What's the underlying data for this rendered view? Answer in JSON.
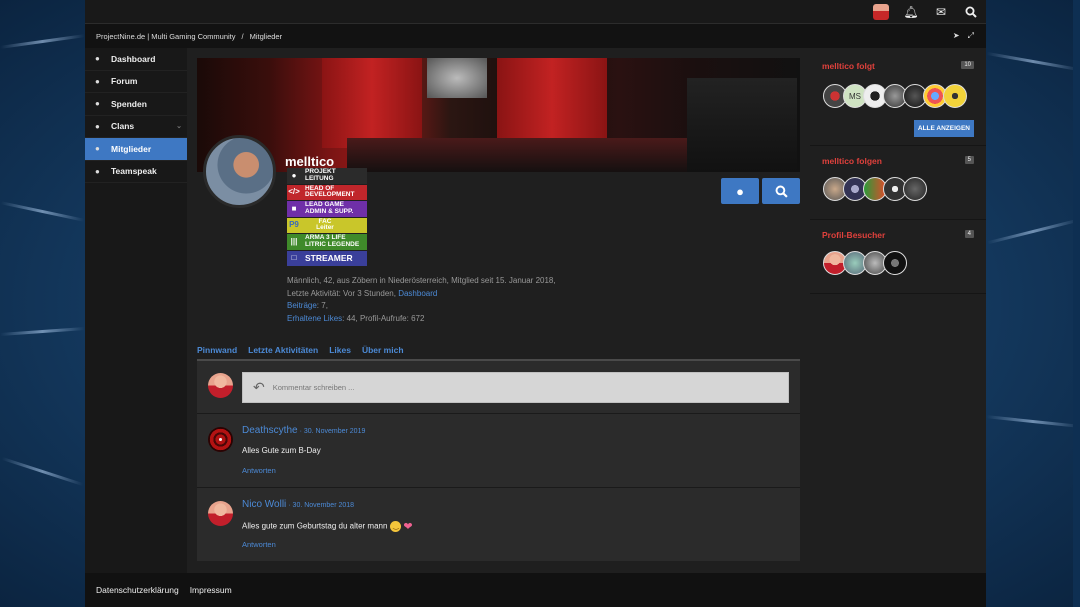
{
  "breadcrumb": {
    "site": "ProjectNine.de | Multi Gaming Community",
    "separator": "/",
    "current": "Mitglieder"
  },
  "topbar": {
    "icons": [
      "user-avatar",
      "bell-icon",
      "chat-icon",
      "search-icon"
    ]
  },
  "sidebar": {
    "items": [
      {
        "label": "Dashboard",
        "icon": "chat-icon",
        "active": false
      },
      {
        "label": "Forum",
        "icon": "chat-icon",
        "active": false
      },
      {
        "label": "Spenden",
        "icon": "chat-icon",
        "active": false
      },
      {
        "label": "Clans",
        "icon": "chat-icon",
        "active": false
      },
      {
        "label": "Mitglieder",
        "icon": "users-icon",
        "active": true
      },
      {
        "label": "Teamspeak",
        "icon": "chat-icon",
        "active": false
      }
    ]
  },
  "profile": {
    "username": "melltico",
    "badges": [
      {
        "line1": "PROJEKT",
        "line2": "LEITUNG",
        "bg": "#2b2b2b",
        "icon": "user-icon"
      },
      {
        "line1": "HEAD OF",
        "line2": "DEVELOPMENT",
        "bg": "#c0262b",
        "icon": "code-icon"
      },
      {
        "line1": "LEAD GAME",
        "line2": "ADMIN & SUPP.",
        "bg": "#6f2fa8",
        "icon": "controller-icon"
      },
      {
        "line1": "FAC",
        "line2": "Leiter",
        "bg": "#c9c62a",
        "icon": "p9-icon"
      },
      {
        "line1": "ARMA 3 LIFE",
        "line2": "LITRIC LEGENDE",
        "bg": "#3f8a2a",
        "icon": "arma-icon"
      },
      {
        "line1": "STREAMER",
        "line2": "",
        "bg": "#3a3f9a",
        "icon": "twitch-icon"
      }
    ],
    "info_line1": "Männlich, 42, aus Zöbern in Niederösterreich, Mitglied seit 15. Januar 2018,",
    "info_activity_label": "Letzte Aktivität: Vor 3 Stunden,",
    "info_activity_link": "Dashboard",
    "info_posts_label": "Beiträge",
    "info_posts_value": ": 7,",
    "info_likes_label": "Erhaltene Likes",
    "info_likes_value": ": 44, Profil-Aufrufe: 672"
  },
  "tabs": [
    "Pinnwand",
    "Letzte Aktivitäten",
    "Likes",
    "Über mich"
  ],
  "composer": {
    "placeholder": "Kommentar schreiben ..."
  },
  "comments": [
    {
      "author": "Deathscythe",
      "date": "· 30. November 2019",
      "text": "Alles Gute zum B-Day",
      "reply": "Antworten"
    },
    {
      "author": "Nico Wolli",
      "date": "· 30. November 2018",
      "text": "Alles gute zum Geburtstag du alter mann",
      "reply": "Antworten"
    }
  ],
  "right": {
    "follows": {
      "title": "melltico folgt",
      "count": "10",
      "button": "ALLE ANZEIGEN"
    },
    "followers": {
      "title": "melltico folgen",
      "count": "5"
    },
    "visitors": {
      "title": "Profil-Besucher",
      "count": "4"
    },
    "ms_avatar": "MS"
  },
  "footer": {
    "links": [
      "Datenschutzerklärung",
      "Impressum"
    ]
  },
  "colors": {
    "accent": "#3e78c3",
    "link": "#4c8ad6",
    "heading_red": "#e0413c"
  }
}
